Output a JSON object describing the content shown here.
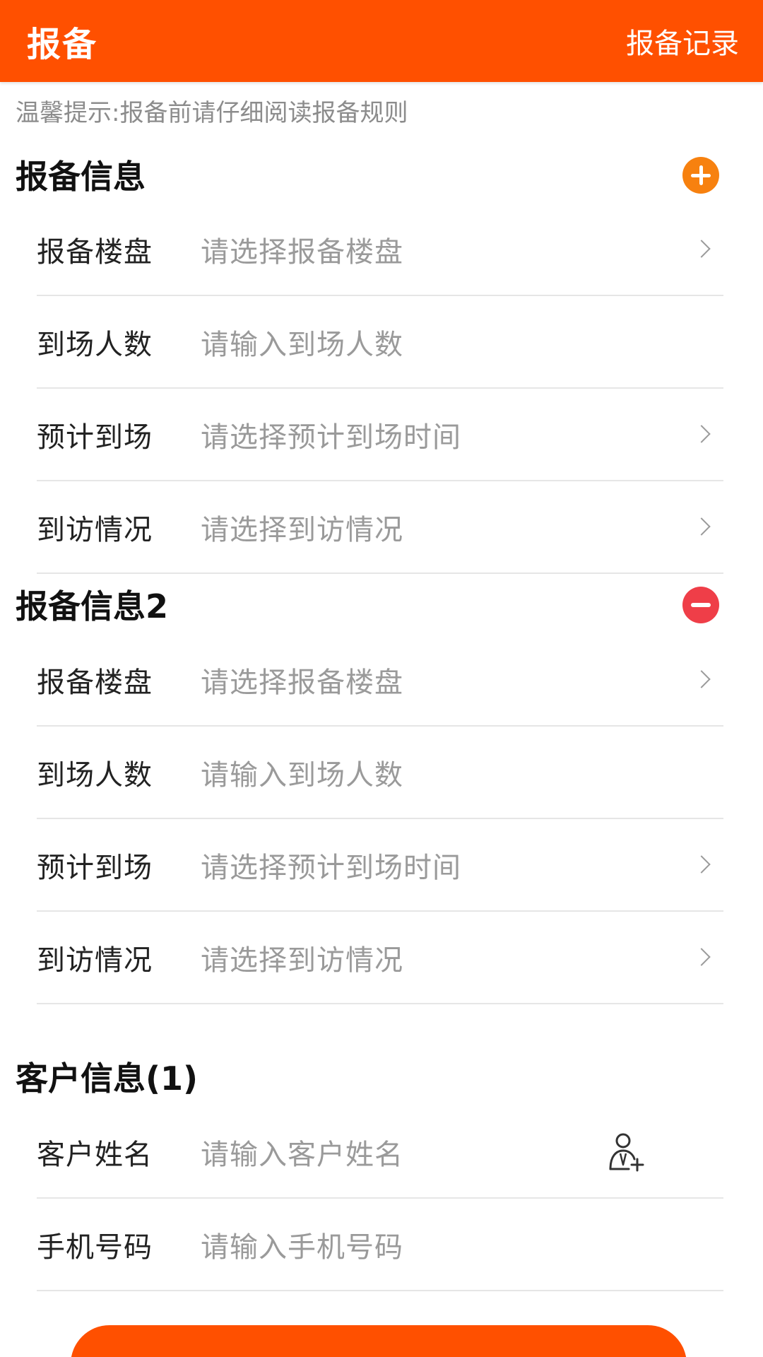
{
  "header": {
    "title": "报备",
    "action": "报备记录"
  },
  "tip": "温馨提示:报备前请仔细阅读报备规则",
  "section1": {
    "title": "报备信息",
    "rows": [
      {
        "label": "报备楼盘",
        "placeholder": "请选择报备楼盘"
      },
      {
        "label": "到场人数",
        "placeholder": "请输入到场人数"
      },
      {
        "label": "预计到场",
        "placeholder": "请选择预计到场时间"
      },
      {
        "label": "到访情况",
        "placeholder": "请选择到访情况"
      }
    ]
  },
  "section2": {
    "title": "报备信息2",
    "rows": [
      {
        "label": "报备楼盘",
        "placeholder": "请选择报备楼盘"
      },
      {
        "label": "到场人数",
        "placeholder": "请输入到场人数"
      },
      {
        "label": "预计到场",
        "placeholder": "请选择预计到场时间"
      },
      {
        "label": "到访情况",
        "placeholder": "请选择到访情况"
      }
    ]
  },
  "customer": {
    "title": "客户信息(1)",
    "rows": [
      {
        "label": "客户姓名",
        "placeholder": "请输入客户姓名"
      },
      {
        "label": "手机号码",
        "placeholder": "请输入手机号码"
      }
    ]
  },
  "icons": {
    "add": "plus-circle-icon",
    "remove": "minus-circle-icon",
    "chevron": "chevron-right-icon",
    "contact": "add-person-icon"
  },
  "colors": {
    "brand": "#ff5000",
    "add": "#f7810f",
    "remove": "#ef3e48",
    "placeholder": "#9a9a9a"
  }
}
